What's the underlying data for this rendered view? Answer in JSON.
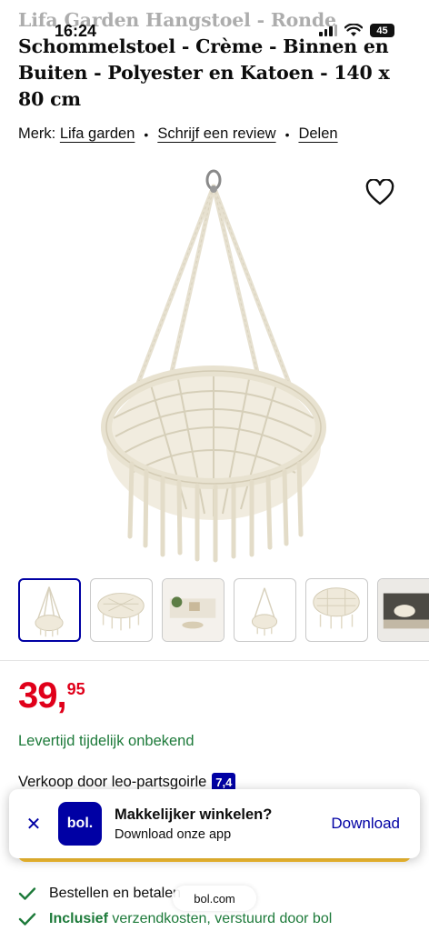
{
  "status_bar": {
    "time": "16:24",
    "battery": "45"
  },
  "product": {
    "title_line1": "Lifa Garden Hangstoel - Ronde",
    "title_rest": "Schommelstoel - Crème - Binnen en Buiten - Polyester en Katoen - 140 x 80 cm",
    "brand_label": "Merk:",
    "brand": "Lifa garden",
    "review_link": "Schrijf een review",
    "share_link": "Delen"
  },
  "price": {
    "integer": "39,",
    "decimals": "95"
  },
  "delivery": "Levertijd tijdelijk onbekend",
  "seller": {
    "text": "Verkoop door leo-partsgoirle",
    "score": "7,4"
  },
  "app_banner": {
    "logo": "bol.",
    "title": "Makkelijker winkelen?",
    "subtitle": "Download onze app",
    "download": "Download"
  },
  "usps": [
    {
      "text": "Bestellen en betalen"
    },
    {
      "strong": "Inclusief",
      "rest": " verzendkosten, verstuurd door bol"
    }
  ],
  "url_bar": "bol.com",
  "colors": {
    "brand_blue": "#0000a4",
    "price_red": "#e0001a",
    "delivery_green": "#1d7a3a",
    "cta_yellow": "#fcc332"
  },
  "icons": [
    "heart-icon",
    "close-icon",
    "check-icon",
    "signal-icon",
    "wifi-icon",
    "battery-icon"
  ]
}
